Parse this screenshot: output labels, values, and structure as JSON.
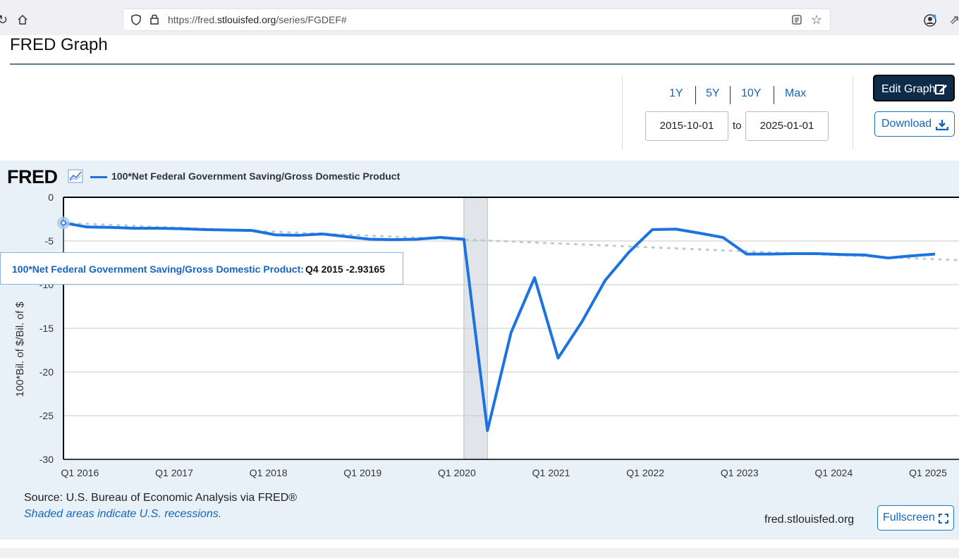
{
  "browser": {
    "url_prefix": "https://fred.",
    "url_domain": "stlouisfed.org",
    "url_path": "/series/FGDEF#",
    "icons": [
      "reload-icon",
      "home-icon",
      "shield-icon",
      "lock-icon",
      "reader-icon",
      "star-icon",
      "account-icon",
      "extensions-icon"
    ]
  },
  "page": {
    "title": "FRED Graph"
  },
  "controls": {
    "ranges": [
      "1Y",
      "5Y",
      "10Y",
      "Max"
    ],
    "start_date": "2015-10-01",
    "to_label": "to",
    "end_date": "2025-01-01",
    "edit_label": "Edit Graph",
    "download_label": "Download"
  },
  "graph": {
    "logo": "FRED",
    "legend": "100*Net Federal Government Saving/Gross Domestic Product",
    "tooltip_name": "100*Net Federal Government Saving/Gross Domestic Product:",
    "tooltip_value": "Q4 2015 -2.93165",
    "source": "Source: U.S. Bureau of Economic Analysis via FRED®",
    "recession_note": "Shaded areas indicate U.S. recessions.",
    "site": "fred.stlouisfed.org",
    "fullscreen_label": "Fullscreen",
    "series_color": "#1a73e0"
  },
  "chart_data": {
    "type": "line",
    "ylabel": "100*Bil. of $/Bil. of $",
    "ylim": [
      -30,
      0
    ],
    "yticks": [
      0,
      -5,
      -10,
      -15,
      -20,
      -25,
      -30
    ],
    "xlim": [
      2015.75,
      2025.0
    ],
    "xticks": [
      {
        "label": "Q1 2016",
        "x": 2016.0
      },
      {
        "label": "Q1 2017",
        "x": 2017.0
      },
      {
        "label": "Q1 2018",
        "x": 2018.0
      },
      {
        "label": "Q1 2019",
        "x": 2019.0
      },
      {
        "label": "Q1 2020",
        "x": 2020.0
      },
      {
        "label": "Q1 2021",
        "x": 2021.0
      },
      {
        "label": "Q1 2022",
        "x": 2022.0
      },
      {
        "label": "Q1 2023",
        "x": 2023.0
      },
      {
        "label": "Q1 2024",
        "x": 2024.0
      },
      {
        "label": "Q1 2025",
        "x": 2025.0
      }
    ],
    "recession": [
      2020.0,
      2020.25
    ],
    "x": [
      2015.75,
      2016.0,
      2016.25,
      2016.5,
      2016.75,
      2017.0,
      2017.25,
      2017.5,
      2017.75,
      2018.0,
      2018.25,
      2018.5,
      2018.75,
      2019.0,
      2019.25,
      2019.5,
      2019.75,
      2020.0,
      2020.25,
      2020.5,
      2020.75,
      2021.0,
      2021.25,
      2021.5,
      2021.75,
      2022.0,
      2022.25,
      2022.5,
      2022.75,
      2023.0,
      2023.25,
      2023.5,
      2023.75,
      2024.0,
      2024.25,
      2024.5,
      2024.75,
      2025.0
    ],
    "values": [
      -2.93,
      -3.4,
      -3.45,
      -3.55,
      -3.55,
      -3.6,
      -3.7,
      -3.75,
      -3.8,
      -4.3,
      -4.35,
      -4.2,
      -4.5,
      -4.8,
      -4.85,
      -4.8,
      -4.6,
      -4.8,
      -26.7,
      -15.5,
      -9.2,
      -18.4,
      -14.3,
      -9.5,
      -6.3,
      -3.7,
      -3.65,
      -4.1,
      -4.6,
      -6.5,
      -6.5,
      -6.45,
      -6.45,
      -6.55,
      -6.6,
      -6.95,
      -6.7,
      -6.5
    ]
  }
}
